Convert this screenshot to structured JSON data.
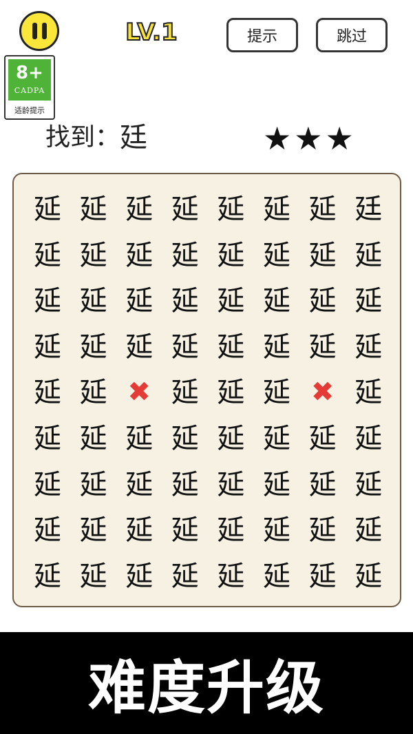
{
  "header": {
    "level": "LV.1",
    "hint_label": "提示",
    "skip_label": "跳过"
  },
  "age_badge": {
    "age": "8+",
    "org": "CADPA",
    "caption": "适龄提示"
  },
  "task": {
    "prefix": "找到：",
    "target": "廷",
    "stars": 3
  },
  "grid": {
    "columns": 8,
    "rows": 9,
    "rows_data": [
      [
        "延",
        "延",
        "延",
        "延",
        "延",
        "延",
        "延",
        "廷"
      ],
      [
        "延",
        "延",
        "延",
        "延",
        "延",
        "延",
        "延",
        "延"
      ],
      [
        "延",
        "延",
        "延",
        "延",
        "延",
        "延",
        "延",
        "延"
      ],
      [
        "延",
        "延",
        "延",
        "延",
        "延",
        "延",
        "延",
        "延"
      ],
      [
        "延",
        "延",
        "",
        "延",
        "延",
        "延",
        "",
        "延"
      ],
      [
        "延",
        "延",
        "延",
        "延",
        "延",
        "延",
        "延",
        "延"
      ],
      [
        "延",
        "延",
        "延",
        "延",
        "延",
        "延",
        "延",
        "延"
      ],
      [
        "延",
        "延",
        "延",
        "延",
        "延",
        "延",
        "延",
        "延"
      ],
      [
        "延",
        "延",
        "延",
        "延",
        "延",
        "延",
        "延",
        "延"
      ]
    ],
    "wrong_marks": [
      [
        4,
        2
      ],
      [
        4,
        6
      ]
    ],
    "mark_symbol": "✖"
  },
  "banner": {
    "text": "难度升级"
  },
  "colors": {
    "level_yellow": "#f7e23a",
    "pause_yellow": "#fbe73a",
    "board_bg": "#f6f1e3",
    "mark_red": "#e53b36",
    "badge_green": "#4fb337"
  }
}
